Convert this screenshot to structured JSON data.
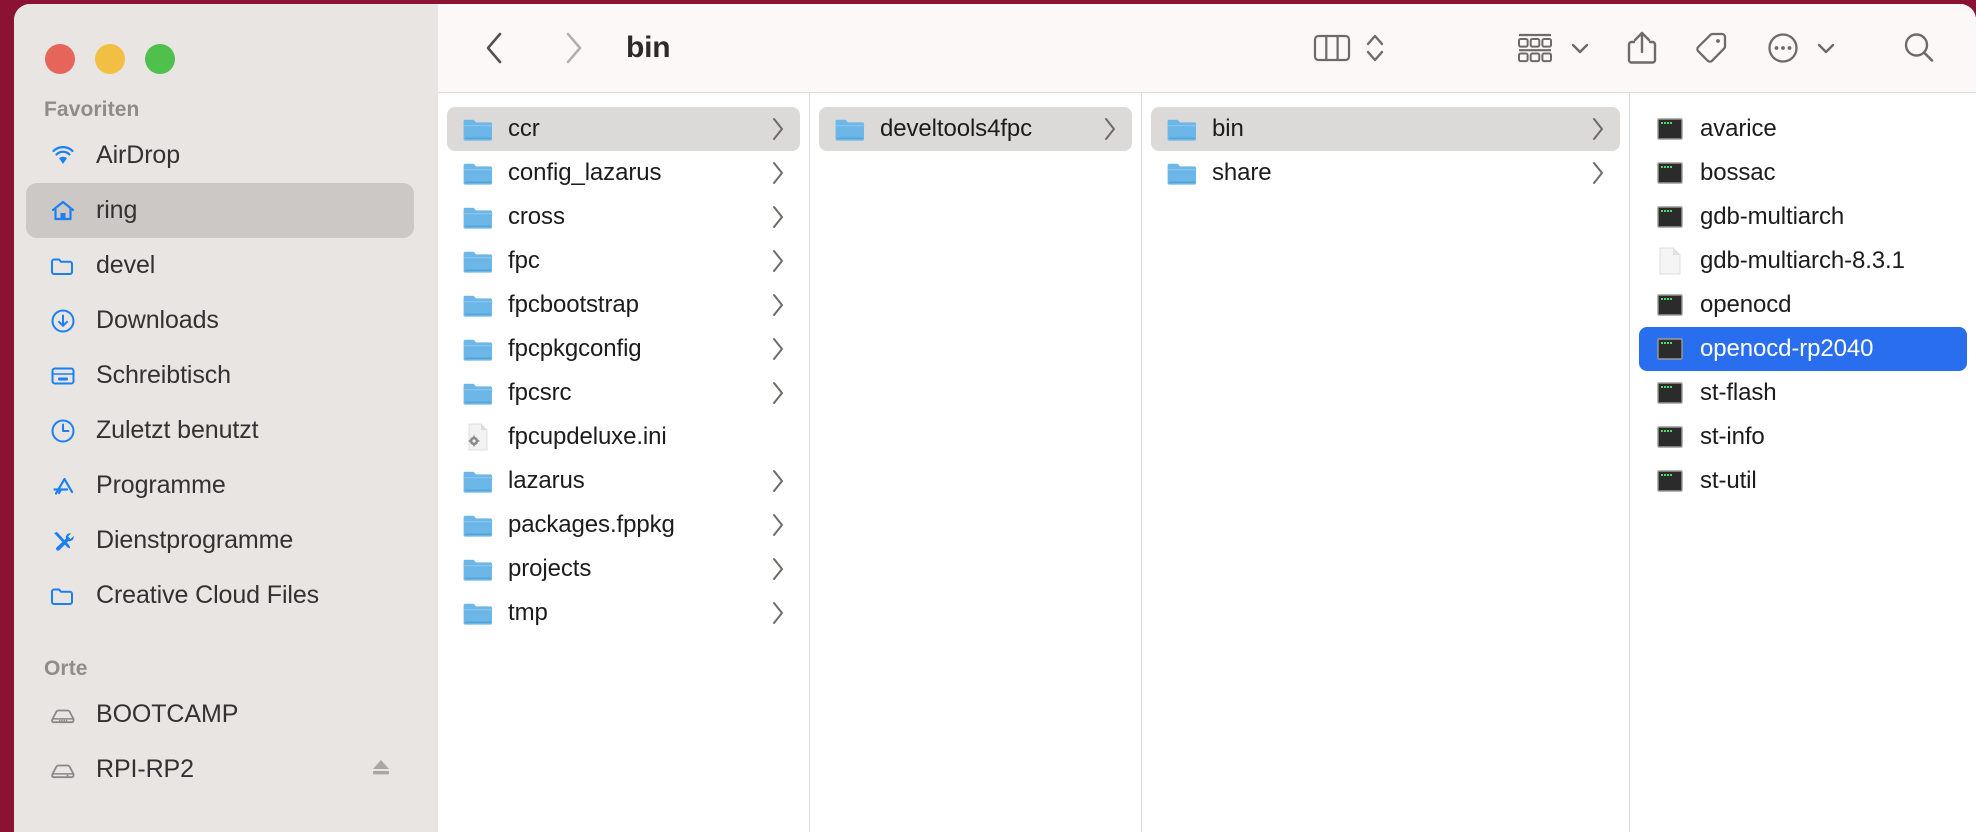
{
  "window": {
    "traffic_lights": [
      "close",
      "minimize",
      "zoom"
    ],
    "colors": {
      "close": "#e6655a",
      "minimize": "#f1bf42",
      "zoom": "#4fc04c",
      "selection_blue": "#2a6ef0",
      "selection_gray": "#dcdad8",
      "sidebar_bg": "#e8e5e3"
    }
  },
  "toolbar": {
    "back_label": "back",
    "forward_label": "forward",
    "title": "bin",
    "view_columns_label": "column-view",
    "view_stepper_label": "view-options",
    "group_label": "group-items",
    "share_label": "share",
    "tags_label": "tags",
    "more_label": "more-actions",
    "search_label": "search"
  },
  "sidebar": {
    "sections": [
      {
        "title": "Favoriten",
        "items": [
          {
            "label": "AirDrop",
            "icon": "airdrop-icon",
            "selected": false
          },
          {
            "label": "ring",
            "icon": "home-icon",
            "selected": true
          },
          {
            "label": "devel",
            "icon": "folder-icon",
            "selected": false
          },
          {
            "label": "Downloads",
            "icon": "download-icon",
            "selected": false
          },
          {
            "label": "Schreibtisch",
            "icon": "desktop-icon",
            "selected": false
          },
          {
            "label": "Zuletzt benutzt",
            "icon": "clock-icon",
            "selected": false
          },
          {
            "label": "Programme",
            "icon": "applications-icon",
            "selected": false
          },
          {
            "label": "Dienstprogramme",
            "icon": "utilities-icon",
            "selected": false
          },
          {
            "label": "Creative Cloud Files",
            "icon": "folder-icon",
            "selected": false
          }
        ]
      },
      {
        "title": "Orte",
        "items": [
          {
            "label": "BOOTCAMP",
            "icon": "drive-icon",
            "selected": false,
            "eject": false
          },
          {
            "label": "RPI-RP2",
            "icon": "drive-icon",
            "selected": false,
            "eject": true
          }
        ]
      }
    ]
  },
  "columns": [
    {
      "name": "column-1",
      "items": [
        {
          "label": "ccr",
          "type": "folder",
          "chevron": true,
          "selected": "gray"
        },
        {
          "label": "config_lazarus",
          "type": "folder",
          "chevron": true,
          "selected": "none"
        },
        {
          "label": "cross",
          "type": "folder",
          "chevron": true,
          "selected": "none"
        },
        {
          "label": "fpc",
          "type": "folder",
          "chevron": true,
          "selected": "none"
        },
        {
          "label": "fpcbootstrap",
          "type": "folder",
          "chevron": true,
          "selected": "none"
        },
        {
          "label": "fpcpkgconfig",
          "type": "folder",
          "chevron": true,
          "selected": "none"
        },
        {
          "label": "fpcsrc",
          "type": "folder",
          "chevron": true,
          "selected": "none"
        },
        {
          "label": "fpcupdeluxe.ini",
          "type": "config",
          "chevron": false,
          "selected": "none"
        },
        {
          "label": "lazarus",
          "type": "folder",
          "chevron": true,
          "selected": "none"
        },
        {
          "label": "packages.fppkg",
          "type": "folder",
          "chevron": true,
          "selected": "none"
        },
        {
          "label": "projects",
          "type": "folder",
          "chevron": true,
          "selected": "none"
        },
        {
          "label": "tmp",
          "type": "folder",
          "chevron": true,
          "selected": "none"
        }
      ]
    },
    {
      "name": "column-2",
      "items": [
        {
          "label": "develtools4fpc",
          "type": "folder",
          "chevron": true,
          "selected": "gray"
        }
      ]
    },
    {
      "name": "column-3",
      "items": [
        {
          "label": "bin",
          "type": "folder",
          "chevron": true,
          "selected": "gray"
        },
        {
          "label": "share",
          "type": "folder",
          "chevron": true,
          "selected": "none"
        }
      ]
    },
    {
      "name": "column-4",
      "items": [
        {
          "label": "avarice",
          "type": "exec",
          "chevron": false,
          "selected": "none"
        },
        {
          "label": "bossac",
          "type": "exec",
          "chevron": false,
          "selected": "none"
        },
        {
          "label": "gdb-multiarch",
          "type": "exec",
          "chevron": false,
          "selected": "none"
        },
        {
          "label": "gdb-multiarch-8.3.1",
          "type": "doc",
          "chevron": false,
          "selected": "none"
        },
        {
          "label": "openocd",
          "type": "exec",
          "chevron": false,
          "selected": "none"
        },
        {
          "label": "openocd-rp2040",
          "type": "exec",
          "chevron": false,
          "selected": "blue"
        },
        {
          "label": "st-flash",
          "type": "exec",
          "chevron": false,
          "selected": "none"
        },
        {
          "label": "st-info",
          "type": "exec",
          "chevron": false,
          "selected": "none"
        },
        {
          "label": "st-util",
          "type": "exec",
          "chevron": false,
          "selected": "none"
        }
      ]
    }
  ]
}
